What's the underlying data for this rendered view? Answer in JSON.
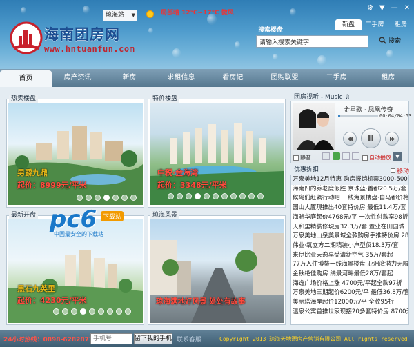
{
  "header": {
    "logo_text": "海南团房网",
    "logo_url": "www.hntuanfun.com",
    "city_select": "琼海站",
    "weather": "局部晴 12℃~17℃ 微风",
    "window_buttons": [
      "⚙",
      "▼",
      "—",
      "✕"
    ],
    "top_tabs": [
      {
        "label": "新盘",
        "active": true
      },
      {
        "label": "二手房",
        "active": false
      },
      {
        "label": "租房",
        "active": false
      }
    ],
    "search_label": "搜索楼盘",
    "search_value": "请输入搜索关键字",
    "search_button": "搜索"
  },
  "nav": {
    "items": [
      {
        "label": "首页",
        "active": true
      },
      {
        "label": "房产资讯",
        "active": false
      },
      {
        "label": "新房",
        "active": false
      },
      {
        "label": "求租信息",
        "active": false
      },
      {
        "label": "看房记",
        "active": false
      },
      {
        "label": "团购联盟",
        "active": false
      },
      {
        "label": "二手房",
        "active": false
      },
      {
        "label": "租房",
        "active": false
      }
    ]
  },
  "panels": {
    "hot": {
      "title": "热卖楼盘",
      "name": "男爵九鼎",
      "price": "起价：8999元/平米"
    },
    "special": {
      "title": "特价楼盘",
      "name": "中税·金海湾",
      "price": "起价：3348元/平米"
    },
    "new": {
      "title": "最新开盘",
      "name": "黑石九英里",
      "price": "起价：4230元/平米"
    },
    "scenery": {
      "title": "琼海风景",
      "caption": "琼海满地好风景 处处有故事"
    }
  },
  "player": {
    "title": "团房视听 - Music ♫",
    "song": "金星歌 · 凤凰传奇",
    "time": "00:04/04:53",
    "mute_label": "静音",
    "autoplay_label": "自动播放"
  },
  "news": {
    "title": "优惠折扣",
    "move_label": "移动",
    "items": [
      "万泉美地12月特惠 购房报销机票3000-5000元",
      "海南凹的养老度假胜 京珠蓝·首都20.5万/套",
      "候鸟们赶紧行动吧 一线海景楼盘·自马都价格",
      "园山大厦現推出40套特价房 最低11.4万/套",
      "海骆华庭起价4768元/平 一次性付款享98折",
      "天和里精装修現房32.3万/套 置业在田园城",
      "万泉美地山泉美景城全款购房手推特价房 28万",
      "伟业·氧立方二期精装小户型仅18.3万/套",
      "来伊比亚天逸享受清新空气 35万/套起",
      "77万入住博鳌一线海景楼盘 亚洲湾潜力无限",
      "金秋绝佳购房 纳景河畔最低28万/套起",
      "海逸广场价格上涨 4700元/平起全款97折",
      "万泉美地三期起价6200元/平 最低36.8万/套",
      "美丽塔海岸起价12000元/平 全款95折",
      "温泉公寓首推世家现接20多套特价房 8700元"
    ]
  },
  "footer": {
    "hotline": "24小时热线：0898-62828777",
    "phone_placeholder": "手机号",
    "leave_button": "留下我的手机",
    "service": "联系客服",
    "copyright": "Copyright 2013 琼海天地源房产营销有限公司 All rights reserved"
  },
  "watermark": {
    "text": "pc6",
    "tag": "下载站",
    "sub": "中国最安全的下载站"
  },
  "colors": {
    "accent": "#2f7db5",
    "caption_yellow": "#e2b417",
    "price_red": "#ff4a3d",
    "footer_yellow": "#ffd326"
  }
}
